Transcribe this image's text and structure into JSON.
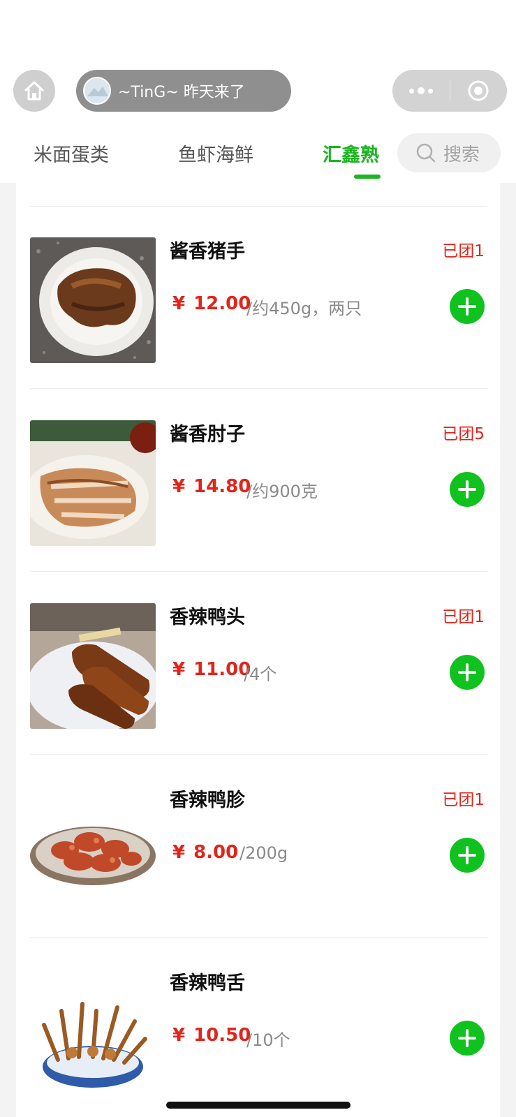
{
  "header": {
    "visitor_text": "~TinG~ 昨天来了",
    "tabs": [
      {
        "label": "米面蛋类"
      },
      {
        "label": "鱼虾海鲜"
      },
      {
        "label": "汇鑫熟"
      }
    ],
    "active_tab": 2,
    "search_placeholder": "搜索"
  },
  "colors": {
    "accent_green": "#1db422",
    "price_red": "#e1251b",
    "add_button_green": "#10c21e"
  },
  "products": [
    {
      "name": "酱香猪手",
      "price": "12.00",
      "currency": "¥",
      "unit": "/约450g，两只",
      "sold": "已团1"
    },
    {
      "name": "酱香肘子",
      "price": "14.80",
      "currency": "¥",
      "unit": "/约900克",
      "sold": "已团5"
    },
    {
      "name": "香辣鸭头",
      "price": "11.00",
      "currency": "¥",
      "unit": "/4个",
      "sold": "已团1"
    },
    {
      "name": "香辣鸭胗",
      "price": "8.00",
      "currency": "¥",
      "unit": "/200g",
      "sold": "已团1"
    },
    {
      "name": "香辣鸭舌",
      "price": "10.50",
      "currency": "¥",
      "unit": "/10个",
      "sold": ""
    }
  ]
}
